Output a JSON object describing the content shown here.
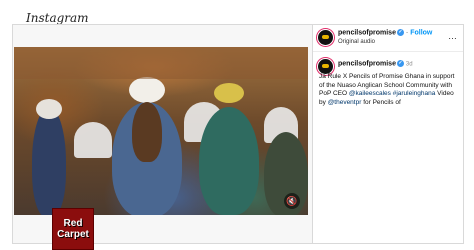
{
  "header": {
    "logo_text": "Instagram"
  },
  "post": {
    "username": "pencilsofpromise",
    "verified": true,
    "follow_label": "Follow",
    "audio": "Original audio",
    "more_label": "…",
    "comment": {
      "username": "pencilsofpromise",
      "time": "3d",
      "caption_part1": "Ja Rule X Pencils of Promise Ghana in support of the Nuaso Anglican School Community with PoP CEO",
      "mention1": "@kaileescales",
      "hashtag": "#jaruleinghana",
      "caption_part2": "Video by",
      "mention2": "@theventpr",
      "caption_part3": "for Pencils of"
    }
  },
  "video": {
    "mute_icon": "speaker-muted-icon"
  },
  "badge": {
    "line1": "Red",
    "line2": "Carpet"
  },
  "colors": {
    "accent": "#0095f6",
    "verified": "#3897f0",
    "badge": "#8b0d0d"
  }
}
